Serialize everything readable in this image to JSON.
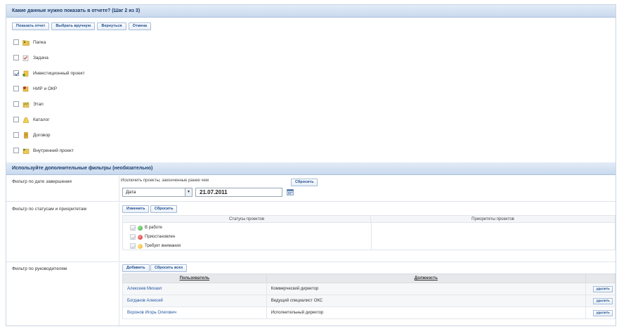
{
  "step": {
    "title": "Какие данные нужно показать в отчете? (Шаг 2 из 3)",
    "buttons": [
      "Показать отчет",
      "Выбрать вручную",
      "Вернуться",
      "Отмена"
    ]
  },
  "object_types": [
    {
      "label": "Папка",
      "checked": false,
      "icon": "folder-icon",
      "color": "#d8b341"
    },
    {
      "label": "Задача",
      "checked": false,
      "icon": "task-icon",
      "color": "#c0392b"
    },
    {
      "label": "Инвестиционный проект",
      "checked": true,
      "icon": "investment-project-icon",
      "color": "#e1a12a"
    },
    {
      "label": "НИР и ОКР",
      "checked": false,
      "icon": "research-icon",
      "color": "#c0392b"
    },
    {
      "label": "Этап",
      "checked": false,
      "icon": "stage-icon",
      "color": "#d4a83a"
    },
    {
      "label": "Каталог",
      "checked": false,
      "icon": "catalog-icon",
      "color": "#e8c233"
    },
    {
      "label": "Договор",
      "checked": false,
      "icon": "contract-icon",
      "color": "#d9a527"
    },
    {
      "label": "Внутренний проект",
      "checked": false,
      "icon": "internal-project-icon",
      "color": "#d4a83a"
    }
  ],
  "filters": {
    "title": "Используйте дополнительные фильтры (необязательно)",
    "date": {
      "label": "Фильтр по дате завершения",
      "note": "Исключить проекты, законченные ранее чем",
      "reset": "Сбросить",
      "select_value": "Дата",
      "date_value": "21.07.2011"
    },
    "status": {
      "label": "Фильтр по статусам и приоритетам",
      "change": "Изменить",
      "reset": "Сбросить",
      "col_status": "Статусы проектов",
      "col_priority": "Приоритеты проектов",
      "statuses": [
        {
          "label": "В работе",
          "color": "#3aa83a"
        },
        {
          "label": "Приостановлен",
          "color": "#d42b2b"
        },
        {
          "label": "Требует внимания",
          "color": "#f0b820"
        }
      ]
    },
    "managers": {
      "label": "Фильтр по руководителям",
      "add": "Добавить",
      "reset_all": "Сбросить всех",
      "col_user": "Пользователь",
      "col_position": "Должность",
      "delete": "удалить",
      "rows": [
        {
          "user": "Алексеев Михаил",
          "position": "Коммерческий директор"
        },
        {
          "user": "Богданов Алексей",
          "position": "Ведущий специалист ОКС"
        },
        {
          "user": "Воронов Игорь Олегович",
          "position": "Исполнительный директор"
        }
      ]
    }
  }
}
